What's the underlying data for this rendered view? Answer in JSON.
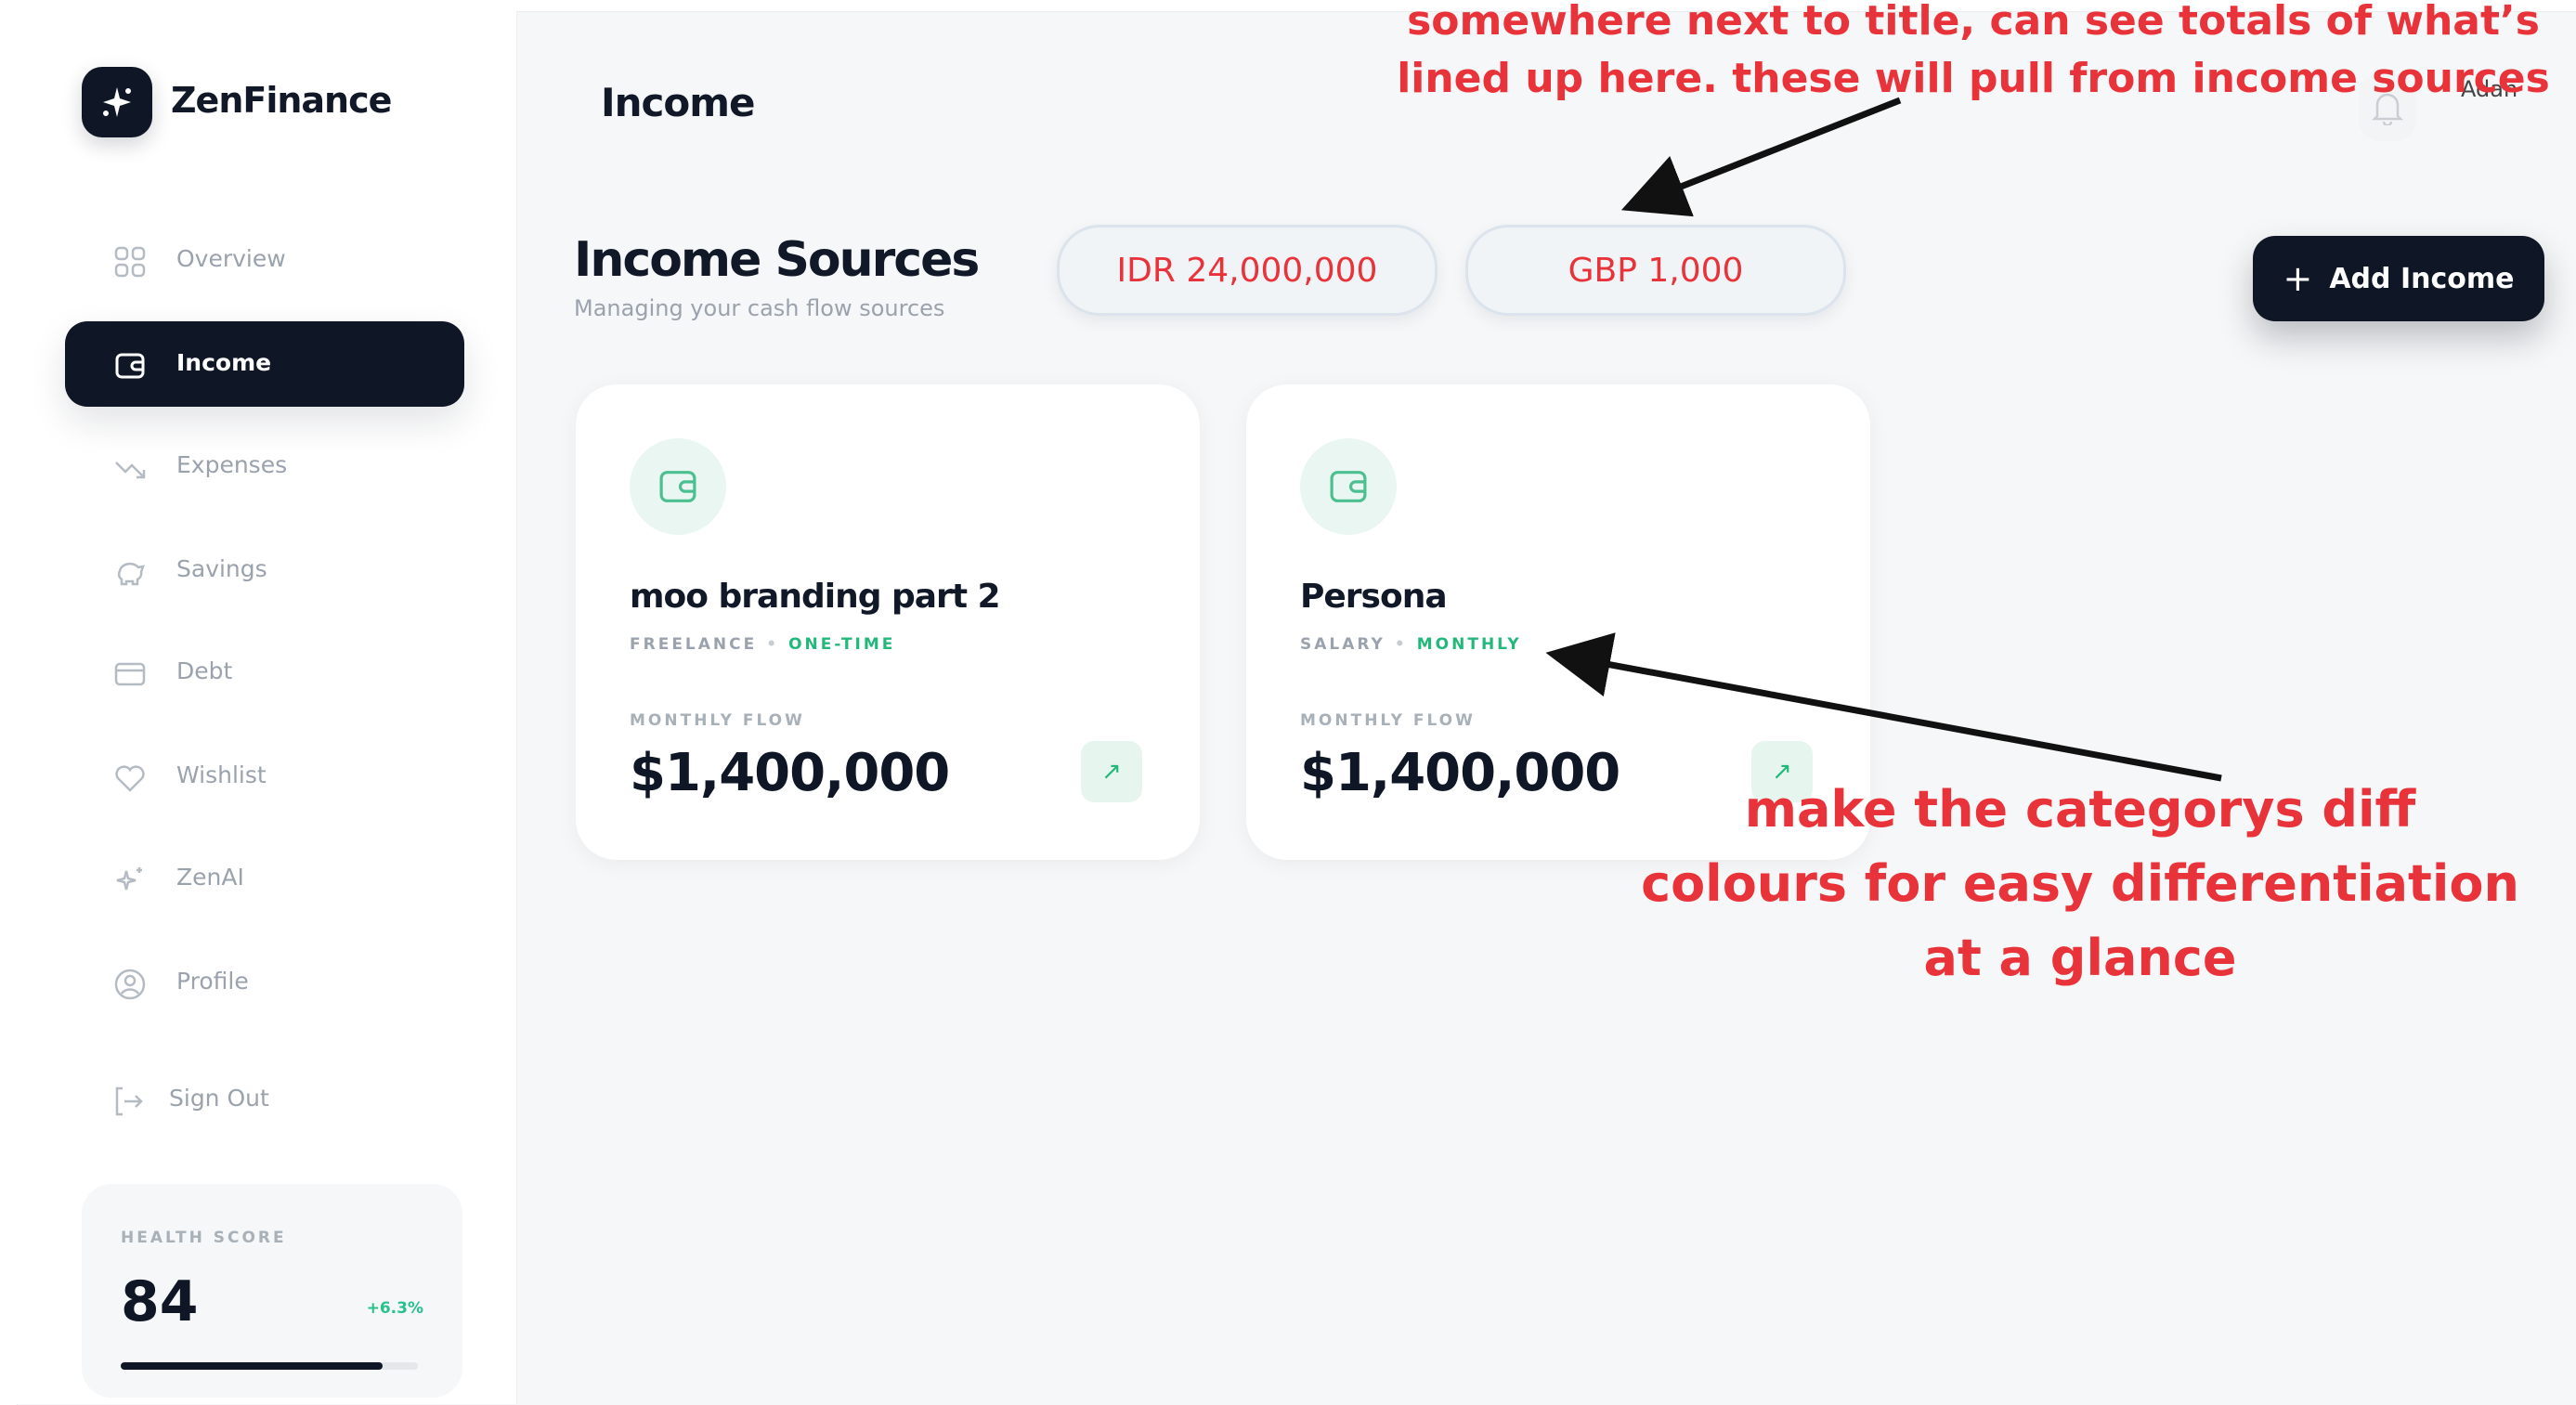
{
  "app": {
    "name": "ZenFinance"
  },
  "sidebar": {
    "items": [
      {
        "label": "Overview",
        "icon": "grid-icon",
        "active": false
      },
      {
        "label": "Income",
        "icon": "wallet-icon",
        "active": true
      },
      {
        "label": "Expenses",
        "icon": "trend-down-icon",
        "active": false
      },
      {
        "label": "Savings",
        "icon": "piggy-bank-icon",
        "active": false
      },
      {
        "label": "Debt",
        "icon": "credit-card-icon",
        "active": false
      },
      {
        "label": "Wishlist",
        "icon": "heart-icon",
        "active": false
      },
      {
        "label": "ZenAI",
        "icon": "sparkles-icon",
        "active": false
      },
      {
        "label": "Profile",
        "icon": "user-circle-icon",
        "active": false
      }
    ],
    "sign_out": "Sign Out",
    "health": {
      "caption": "HEALTH SCORE",
      "score": "84",
      "delta": "+6.3%",
      "progress": 0.88
    }
  },
  "header": {
    "title": "Income",
    "avatar_alt": "Adan"
  },
  "main": {
    "title": "Income Sources",
    "subtitle": "Managing your cash flow sources",
    "totals": [
      "IDR 24,000,000",
      "GBP 1,000"
    ],
    "add_button": "Add Income",
    "cards": [
      {
        "name": "moo branding part 2",
        "category": "FREELANCE",
        "frequency": "ONE-TIME",
        "flow_caption": "MONTHLY FLOW",
        "amount": "$1,400,000"
      },
      {
        "name": "Persona",
        "category": "SALARY",
        "frequency": "MONTHLY",
        "flow_caption": "MONTHLY FLOW",
        "amount": "$1,400,000"
      }
    ]
  },
  "annotations": {
    "top": "somewhere next to title, can see totals of what’s lined up here. these will pull from income sources",
    "bottom": "make the categorys diff colours for easy differentiation at a glance"
  },
  "colors": {
    "accent_dark": "#0f1726",
    "green": "#22b87a",
    "annotation_red": "#e8333a"
  }
}
